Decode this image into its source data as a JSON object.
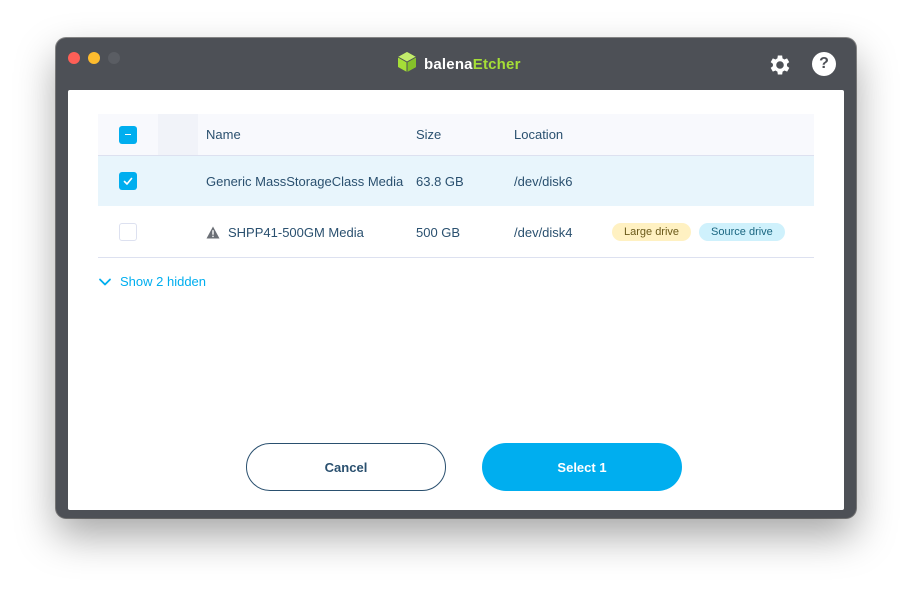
{
  "titlebar": {
    "brand_primary": "balena",
    "brand_accent": "Etcher",
    "brand_accent_color": "#a5de37"
  },
  "icons": {
    "settings": "gear-icon",
    "help": "help-icon",
    "help_glyph": "?",
    "warning": "warning-icon",
    "chevron": "chevron-down-icon"
  },
  "table": {
    "columns": [
      "Name",
      "Size",
      "Location"
    ],
    "rows": [
      {
        "checked": true,
        "name": "Generic MassStorageClass Media",
        "size": "63.8 GB",
        "location": "/dev/disk6",
        "badges": []
      },
      {
        "checked": false,
        "warning": true,
        "name": "SHPP41-500GM Media",
        "size": "500 GB",
        "location": "/dev/disk4",
        "badges": [
          "Large drive",
          "Source drive"
        ]
      }
    ]
  },
  "show_hidden_label": "Show 2 hidden",
  "buttons": {
    "cancel": "Cancel",
    "select": "Select 1"
  },
  "colors": {
    "accent": "#00aeef",
    "text": "#2a506f",
    "window": "#4d5056"
  }
}
